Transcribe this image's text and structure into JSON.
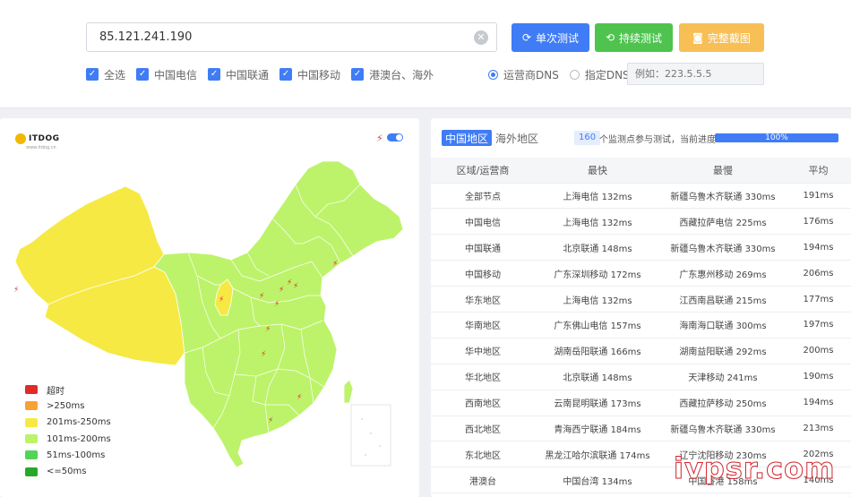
{
  "search": {
    "ip_value": "85.121.241.190"
  },
  "buttons": {
    "single": "单次测试",
    "continuous": "持续测试",
    "screenshot": "完整截图"
  },
  "checkboxes": [
    "全选",
    "中国电信",
    "中国联通",
    "中国移动",
    "港澳台、海外"
  ],
  "dns": {
    "isp_dns": "运营商DNS",
    "custom_dns": "指定DNS:",
    "placeholder": "例如：223.5.5.5",
    "selected": "运营商DNS"
  },
  "map": {
    "logo": "ITDOG",
    "logo_sub": "www.itdog.cn",
    "legend": [
      {
        "label": "超时",
        "color": "#e02b2b"
      },
      {
        "label": ">250ms",
        "color": "#f8a136"
      },
      {
        "label": "201ms-250ms",
        "color": "#f6e944"
      },
      {
        "label": "101ms-200ms",
        "color": "#bdf36a"
      },
      {
        "label": "51ms-100ms",
        "color": "#52d454"
      },
      {
        "label": "<=50ms",
        "color": "#27a82b"
      }
    ]
  },
  "results": {
    "tabs": [
      "中国地区",
      "海外地区"
    ],
    "active_tab": "中国地区",
    "node_count": "160",
    "progress_text": "个监测点参与测试，当前进度：",
    "progress_label": "100%",
    "progress_fraction": 1.0,
    "columns": [
      "区域/运营商",
      "最快",
      "最慢",
      "平均"
    ],
    "rows": [
      [
        "全部节点",
        "上海电信 132ms",
        "新疆乌鲁木齐联通 330ms",
        "191ms"
      ],
      [
        "中国电信",
        "上海电信 132ms",
        "西藏拉萨电信 225ms",
        "176ms"
      ],
      [
        "中国联通",
        "北京联通 148ms",
        "新疆乌鲁木齐联通 330ms",
        "194ms"
      ],
      [
        "中国移动",
        "广东深圳移动 172ms",
        "广东惠州移动 269ms",
        "206ms"
      ],
      [
        "华东地区",
        "上海电信 132ms",
        "江西南昌联通 215ms",
        "177ms"
      ],
      [
        "华南地区",
        "广东佛山电信 157ms",
        "海南海口联通 300ms",
        "197ms"
      ],
      [
        "华中地区",
        "湖南岳阳联通 166ms",
        "湖南益阳联通 292ms",
        "200ms"
      ],
      [
        "华北地区",
        "北京联通 148ms",
        "天津移动 241ms",
        "190ms"
      ],
      [
        "西南地区",
        "云南昆明联通 173ms",
        "西藏拉萨移动 250ms",
        "194ms"
      ],
      [
        "西北地区",
        "青海西宁联通 184ms",
        "新疆乌鲁木齐联通 330ms",
        "213ms"
      ],
      [
        "东北地区",
        "黑龙江哈尔滨联通 174ms",
        "辽宁沈阳移动 230ms",
        "202ms"
      ],
      [
        "港澳台",
        "中国台湾 134ms",
        "中国香港 158ms",
        "140ms"
      ]
    ]
  },
  "watermark": "ivpsr.com",
  "colors": {
    "accent": "#3f7cf6",
    "green": "#4ec44f",
    "orange": "#f7bf55",
    "map_green": "#bdf36a",
    "map_yellow": "#f6e944"
  }
}
